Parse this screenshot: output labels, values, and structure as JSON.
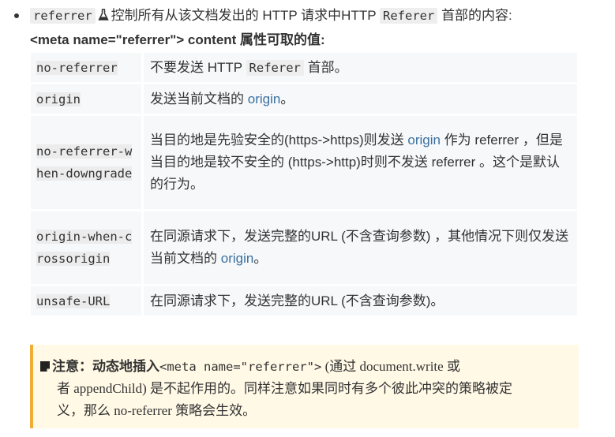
{
  "intro": {
    "code": "referrer",
    "icon": "experimental-flask-icon",
    "text": "控制所有从该文档发出的 HTTP 请求中HTTP",
    "header_code": "Referer",
    "text_after": "首部的内容:"
  },
  "heading": {
    "text": "<meta name=\"referrer\"> content 属性可取的值:"
  },
  "table": {
    "rows": [
      {
        "key": "no-referrer",
        "desc_before": "不要发送 HTTP",
        "desc_code": "Referer",
        "desc_after": "首部。"
      },
      {
        "key": "origin",
        "desc_before": "发送当前文档的",
        "desc_link": "origin",
        "desc_after": "。"
      },
      {
        "key": "no-referrer-when-downgrade",
        "desc_before": "当目的地是先验安全的(https->https)则发送",
        "desc_link": "origin",
        "desc_after": "作为 referrer ，但是当目的地是较不安全的 (https->http)时则不发送 referrer 。这个是默认的行为。"
      },
      {
        "key": "origin-when-crossorigin",
        "desc_before": "在同源请求下，发送完整的URL (不含查询参数) ，其他情况下则仅发送当前文档的",
        "desc_link": "origin",
        "desc_after": "。"
      },
      {
        "key": "unsafe-URL",
        "desc_before": "在同源请求下，发送完整的URL (不含查询参数)。"
      }
    ]
  },
  "note": {
    "icon": "note-icon",
    "label": "注意",
    "colon": "：",
    "text_before": "动态地插入",
    "code": "<meta name=\"referrer\">",
    "line1_after": "(通过 document.write 或",
    "line2": "者 appendChild) 是不起作用的。同样注意如果同时有多个彼此冲突的策略被定",
    "line3": "义，那么 no-referrer 策略会生效。",
    "colors": {
      "background": "#fff9e6",
      "border": "#f0ad36"
    }
  },
  "colors": {
    "link": "#3a6fa0",
    "code_bg": "#eeeeee",
    "table_bg": "#f6f8fa"
  }
}
